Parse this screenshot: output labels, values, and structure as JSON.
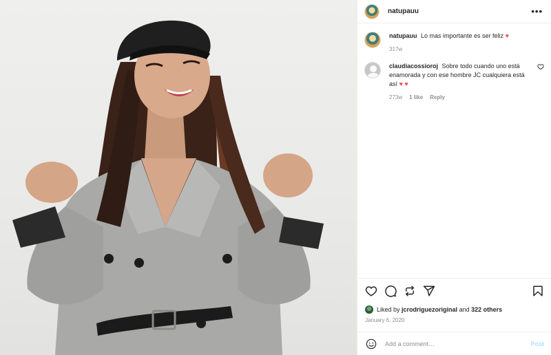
{
  "header": {
    "username": "natupauu",
    "more_label": "•••",
    "avatar_icon": "profile-avatar"
  },
  "caption": {
    "username": "natupauu",
    "text": "Lo mas importante es ser feliz",
    "emoji": "♥",
    "time": "317w"
  },
  "comments": [
    {
      "username": "claudiacossioroj",
      "text": "Sobre todo cuando uno está enamorada y con ese hombre JC cualquiera está así",
      "emoji": "♥ ♥",
      "time": "273w",
      "likes": "1 like",
      "reply_label": "Reply"
    }
  ],
  "actions": {
    "icons": [
      "heart-icon",
      "comment-icon",
      "repost-icon",
      "share-icon",
      "bookmark-icon"
    ]
  },
  "likes": {
    "prefix": "Liked by",
    "user": "jcrodriguezoriginal",
    "connector": "and",
    "others": "322 others"
  },
  "date": "January 6, 2020",
  "add_comment": {
    "placeholder": "Add a comment…",
    "post_label": "Post"
  },
  "colors": {
    "heart": "#ed4956",
    "post_button": "#b2dffc",
    "muted": "#8e8e8e"
  }
}
